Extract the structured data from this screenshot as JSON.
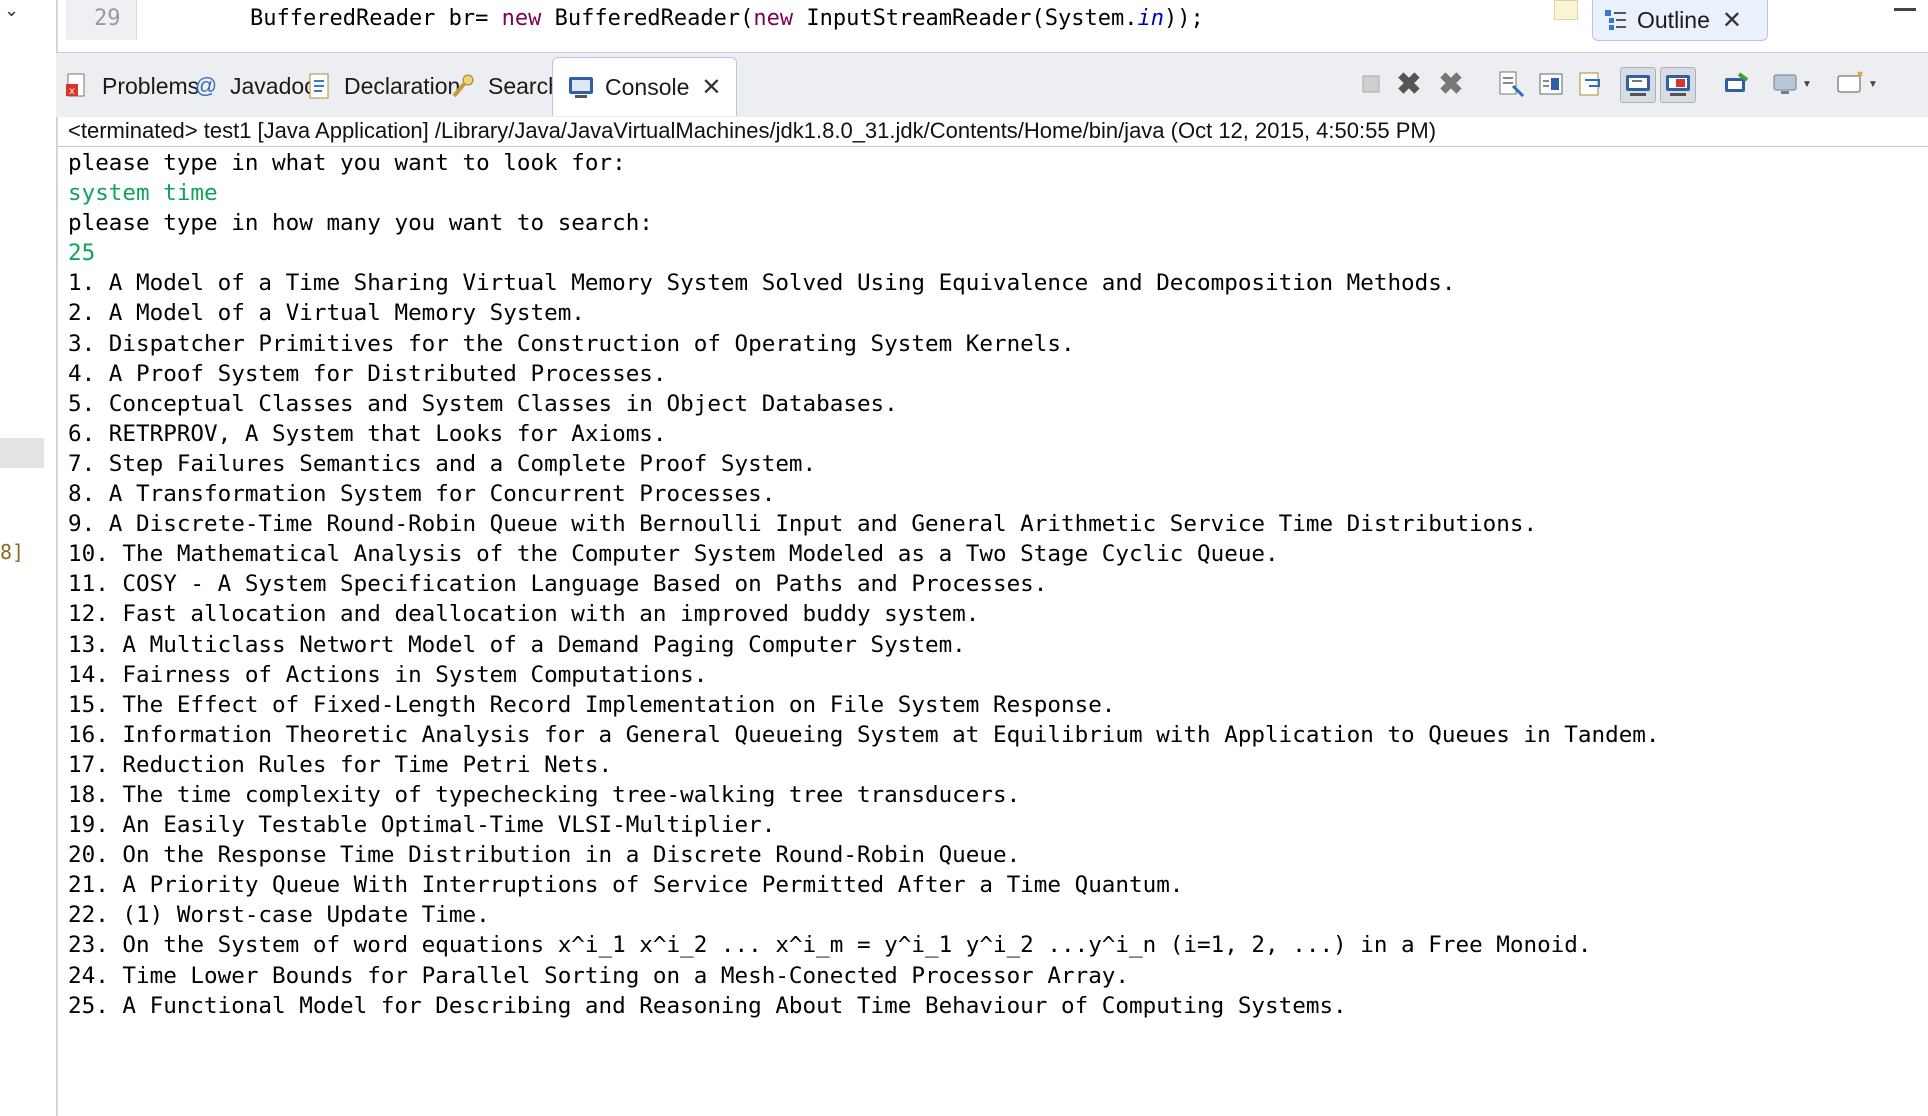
{
  "editor": {
    "line_number": "29",
    "code": {
      "part1": "BufferedReader br= ",
      "kw1": "new",
      "part2": " BufferedReader(",
      "kw2": "new",
      "part3": " InputStreamReader(System.",
      "field": "in",
      "part4": "));"
    }
  },
  "outline_tab": {
    "label": "Outline"
  },
  "left_gutter": {
    "fragment": "8]"
  },
  "tabs": [
    {
      "label": "Problems",
      "icon": "problems-icon"
    },
    {
      "label": "Javadoc",
      "icon": "javadoc-icon"
    },
    {
      "label": "Declaration",
      "icon": "declaration-icon"
    },
    {
      "label": "Search",
      "icon": "search-icon"
    },
    {
      "label": "Console",
      "icon": "console-icon",
      "active": true
    }
  ],
  "console": {
    "status": "<terminated> test1 [Java Application] /Library/Java/JavaVirtualMachines/jdk1.8.0_31.jdk/Contents/Home/bin/java (Oct 12, 2015, 4:50:55 PM)",
    "lines": [
      {
        "text": "please type in what you want to look for:",
        "input": false
      },
      {
        "text": "system time",
        "input": true
      },
      {
        "text": "please type in how many you want to search:",
        "input": false
      },
      {
        "text": "25",
        "input": true
      },
      {
        "text": "1. A Model of a Time Sharing Virtual Memory System Solved Using Equivalence and Decomposition Methods.",
        "input": false
      },
      {
        "text": "2. A Model of a Virtual Memory System.",
        "input": false
      },
      {
        "text": "3. Dispatcher Primitives for the Construction of Operating System Kernels.",
        "input": false
      },
      {
        "text": "4. A Proof System for Distributed Processes.",
        "input": false
      },
      {
        "text": "5. Conceptual Classes and System Classes in Object Databases.",
        "input": false
      },
      {
        "text": "6. RETRPROV, A System that Looks for Axioms.",
        "input": false
      },
      {
        "text": "7. Step Failures Semantics and a Complete Proof System.",
        "input": false
      },
      {
        "text": "8. A Transformation System for Concurrent Processes.",
        "input": false
      },
      {
        "text": "9. A Discrete-Time Round-Robin Queue with Bernoulli Input and General Arithmetic Service Time Distributions.",
        "input": false
      },
      {
        "text": "10. The Mathematical Analysis of the Computer System Modeled as a Two Stage Cyclic Queue.",
        "input": false
      },
      {
        "text": "11. COSY - A System Specification Language Based on Paths and Processes.",
        "input": false
      },
      {
        "text": "12. Fast allocation and deallocation with an improved buddy system.",
        "input": false
      },
      {
        "text": "13. A Multiclass Networt Model of a Demand Paging Computer System.",
        "input": false
      },
      {
        "text": "14. Fairness of Actions in System Computations.",
        "input": false
      },
      {
        "text": "15. The Effect of Fixed-Length Record Implementation on File System Response.",
        "input": false
      },
      {
        "text": "16. Information Theoretic Analysis for a General Queueing System at Equilibrium with Application to Queues in Tandem.",
        "input": false
      },
      {
        "text": "17. Reduction Rules for Time Petri Nets.",
        "input": false
      },
      {
        "text": "18. The time complexity of typechecking tree-walking tree transducers.",
        "input": false
      },
      {
        "text": "19. An Easily Testable Optimal-Time VLSI-Multiplier.",
        "input": false
      },
      {
        "text": "20. On the Response Time Distribution in a Discrete Round-Robin Queue.",
        "input": false
      },
      {
        "text": "21. A Priority Queue With Interruptions of Service Permitted After a Time Quantum.",
        "input": false
      },
      {
        "text": "22. (1) Worst-case Update Time.",
        "input": false
      },
      {
        "text": "23. On the System of word equations x^i_1 x^i_2 ... x^i_m = y^i_1 y^i_2 ...y^i_n (i=1, 2, ...) in a Free Monoid.",
        "input": false
      },
      {
        "text": "24. Time Lower Bounds for Parallel Sorting on a Mesh-Conected Processor Array.",
        "input": false
      },
      {
        "text": "25. A Functional Model for Describing and Reasoning About Time Behaviour of Computing Systems.",
        "input": false
      }
    ]
  },
  "colors": {
    "input_text": "#12a35a",
    "keyword": "#7f0055",
    "field": "#0000c0"
  }
}
